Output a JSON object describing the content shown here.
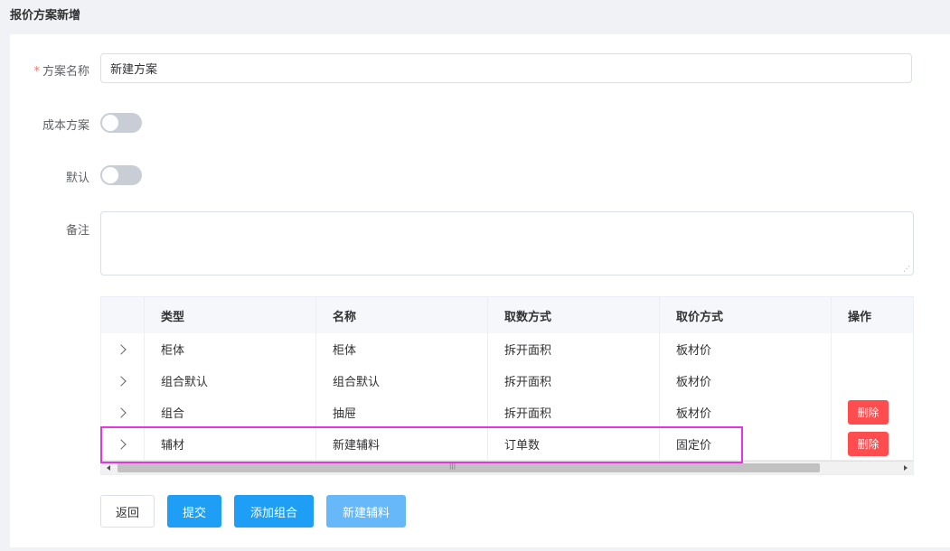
{
  "page": {
    "title": "报价方案新增"
  },
  "form": {
    "name_label": "方案名称",
    "name_required": "*",
    "name_value": "新建方案",
    "cost_label": "成本方案",
    "cost_on": false,
    "default_label": "默认",
    "default_on": false,
    "remark_label": "备注",
    "remark_value": ""
  },
  "table": {
    "columns": [
      "类型",
      "名称",
      "取数方式",
      "取价方式",
      "操作"
    ],
    "rows": [
      {
        "type": "柜体",
        "name": "柜体",
        "fetch": "拆开面积",
        "price": "板材价",
        "action": ""
      },
      {
        "type": "组合默认",
        "name": "组合默认",
        "fetch": "拆开面积",
        "price": "板材价",
        "action": ""
      },
      {
        "type": "组合",
        "name": "抽屉",
        "fetch": "拆开面积",
        "price": "板材价",
        "action": "删除"
      },
      {
        "type": "辅材",
        "name": "新建辅料",
        "fetch": "订单数",
        "price": "固定价",
        "action": "删除"
      }
    ]
  },
  "buttons": {
    "back": "返回",
    "submit": "提交",
    "add_group": "添加组合",
    "new_material": "新建辅料"
  },
  "colors": {
    "primary": "#1e9ef5",
    "danger": "#ff4d4f",
    "highlight": "#e535e0"
  }
}
